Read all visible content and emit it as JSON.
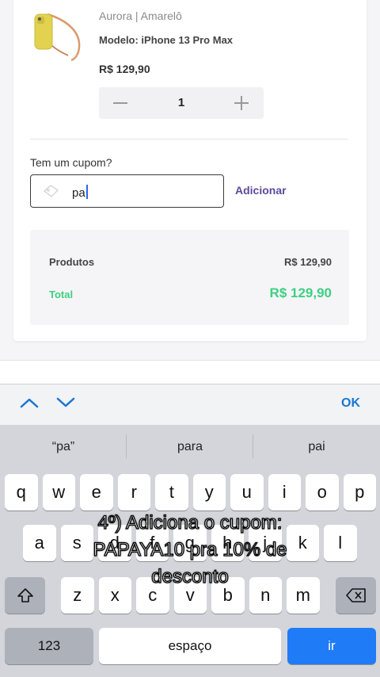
{
  "product": {
    "brand": "Aurora | Amarelô",
    "model": "Modelo: iPhone 13 Pro Max",
    "price": "R$ 129,90",
    "quantity": "1"
  },
  "coupon": {
    "label": "Tem um cupom?",
    "value": "pa",
    "add_label": "Adicionar"
  },
  "summary": {
    "products_label": "Produtos",
    "products_value": "R$ 129,90",
    "total_label": "Total",
    "total_value": "R$ 129,90",
    "total_color": "#3ecf82"
  },
  "keyboard_toolbar": {
    "ok_label": "OK",
    "accent": "#1877d4"
  },
  "suggestions": [
    "“pa”",
    "para",
    "pai"
  ],
  "keyboard": {
    "row1": [
      "q",
      "w",
      "e",
      "r",
      "t",
      "y",
      "u",
      "i",
      "o",
      "p"
    ],
    "row2": [
      "a",
      "s",
      "d",
      "f",
      "g",
      "h",
      "j",
      "k",
      "l"
    ],
    "row3": [
      "z",
      "x",
      "c",
      "v",
      "b",
      "n",
      "m"
    ],
    "numbers_label": "123",
    "space_label": "espaço",
    "go_label": "ir",
    "go_color": "#1f7bf6"
  },
  "caption": {
    "line1": "4º) Adiciona o cupom:",
    "line2": "PAPAYA10 pra 10% de",
    "line3": "desconto"
  }
}
